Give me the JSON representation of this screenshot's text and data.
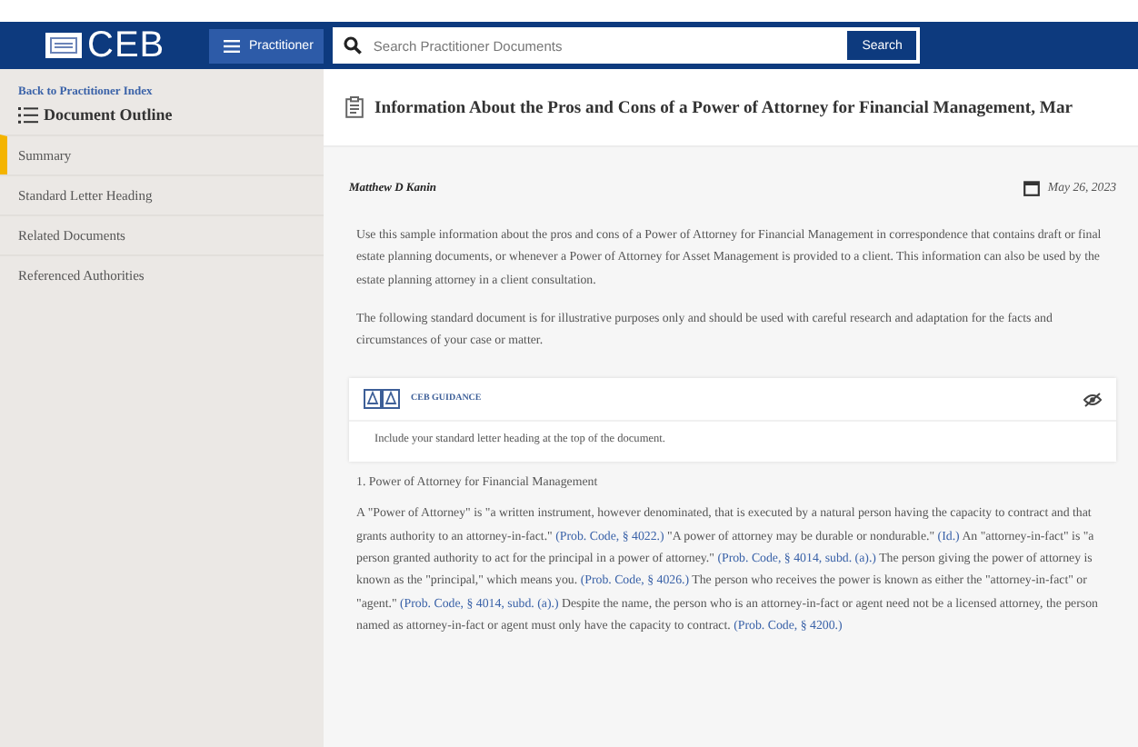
{
  "header": {
    "logo": "CEB",
    "menu_button": "Practitioner",
    "search": {
      "placeholder": "Search Practitioner Documents"
    },
    "search_button": "Search"
  },
  "sidebar": {
    "back_link": "Back to Practitioner Index",
    "outline_title": "Document Outline",
    "items": [
      {
        "label": "Summary",
        "selected": true
      },
      {
        "label": "Standard Letter Heading",
        "selected": false
      },
      {
        "label": "Related Documents",
        "selected": false
      },
      {
        "label": "Referenced Authorities",
        "selected": false
      }
    ]
  },
  "document": {
    "title": "Information About the Pros and Cons of a Power of Attorney for Financial Management, Mar",
    "author": "Matthew D Kanin",
    "date": "May 26, 2023",
    "paragraphs": [
      "Use this sample information about the pros and cons of a Power of Attorney for Financial Management in correspondence that contains draft or final estate planning documents, or whenever a Power of Attorney for Asset Management is provided to a client. This information can also be used by the estate planning attorney in a client consultation.",
      "The following standard document is for illustrative purposes only and should be used with careful research and adaptation for the facts and circumstances of your case or matter."
    ],
    "guidance": {
      "label": "CEB GUIDANCE",
      "text": "Include your standard letter heading at the top of the document."
    },
    "section_heading": "1. Power of Attorney for Financial Management",
    "section_body": [
      {
        "kind": "text",
        "text": "A \"Power of Attorney\" is \"a written instrument, however denominated, that is executed by a natural person having the capacity to contract and that grants authority to an attorney-in-fact.\" "
      },
      {
        "kind": "link",
        "text": "(Prob. Code, § 4022.)"
      },
      {
        "kind": "text",
        "text": " \"A power of attorney may be durable or nondurable.\" "
      },
      {
        "kind": "link",
        "text": "(Id.)"
      },
      {
        "kind": "text",
        "text": " An \"attorney-in-fact\" is \"a person granted authority to act for the principal in a power of attorney.\" "
      },
      {
        "kind": "link",
        "text": "(Prob. Code, § 4014, subd. (a).)"
      },
      {
        "kind": "text",
        "text": " The person giving the power of attorney is known as the \"principal,\" which means you. "
      },
      {
        "kind": "link",
        "text": "(Prob. Code, § 4026.)"
      },
      {
        "kind": "text",
        "text": " The person who receives the power is known as either the \"attorney-in-fact\" or \"agent.\" "
      },
      {
        "kind": "link",
        "text": "(Prob. Code, § 4014, subd. (a).)"
      },
      {
        "kind": "text",
        "text": " Despite the name, the person who is an attorney-in-fact or agent need not be a licensed attorney, the person named as attorney-in-fact or agent must only have the capacity to contract. "
      },
      {
        "kind": "link",
        "text": "(Prob. Code, § 4200.)"
      }
    ]
  }
}
